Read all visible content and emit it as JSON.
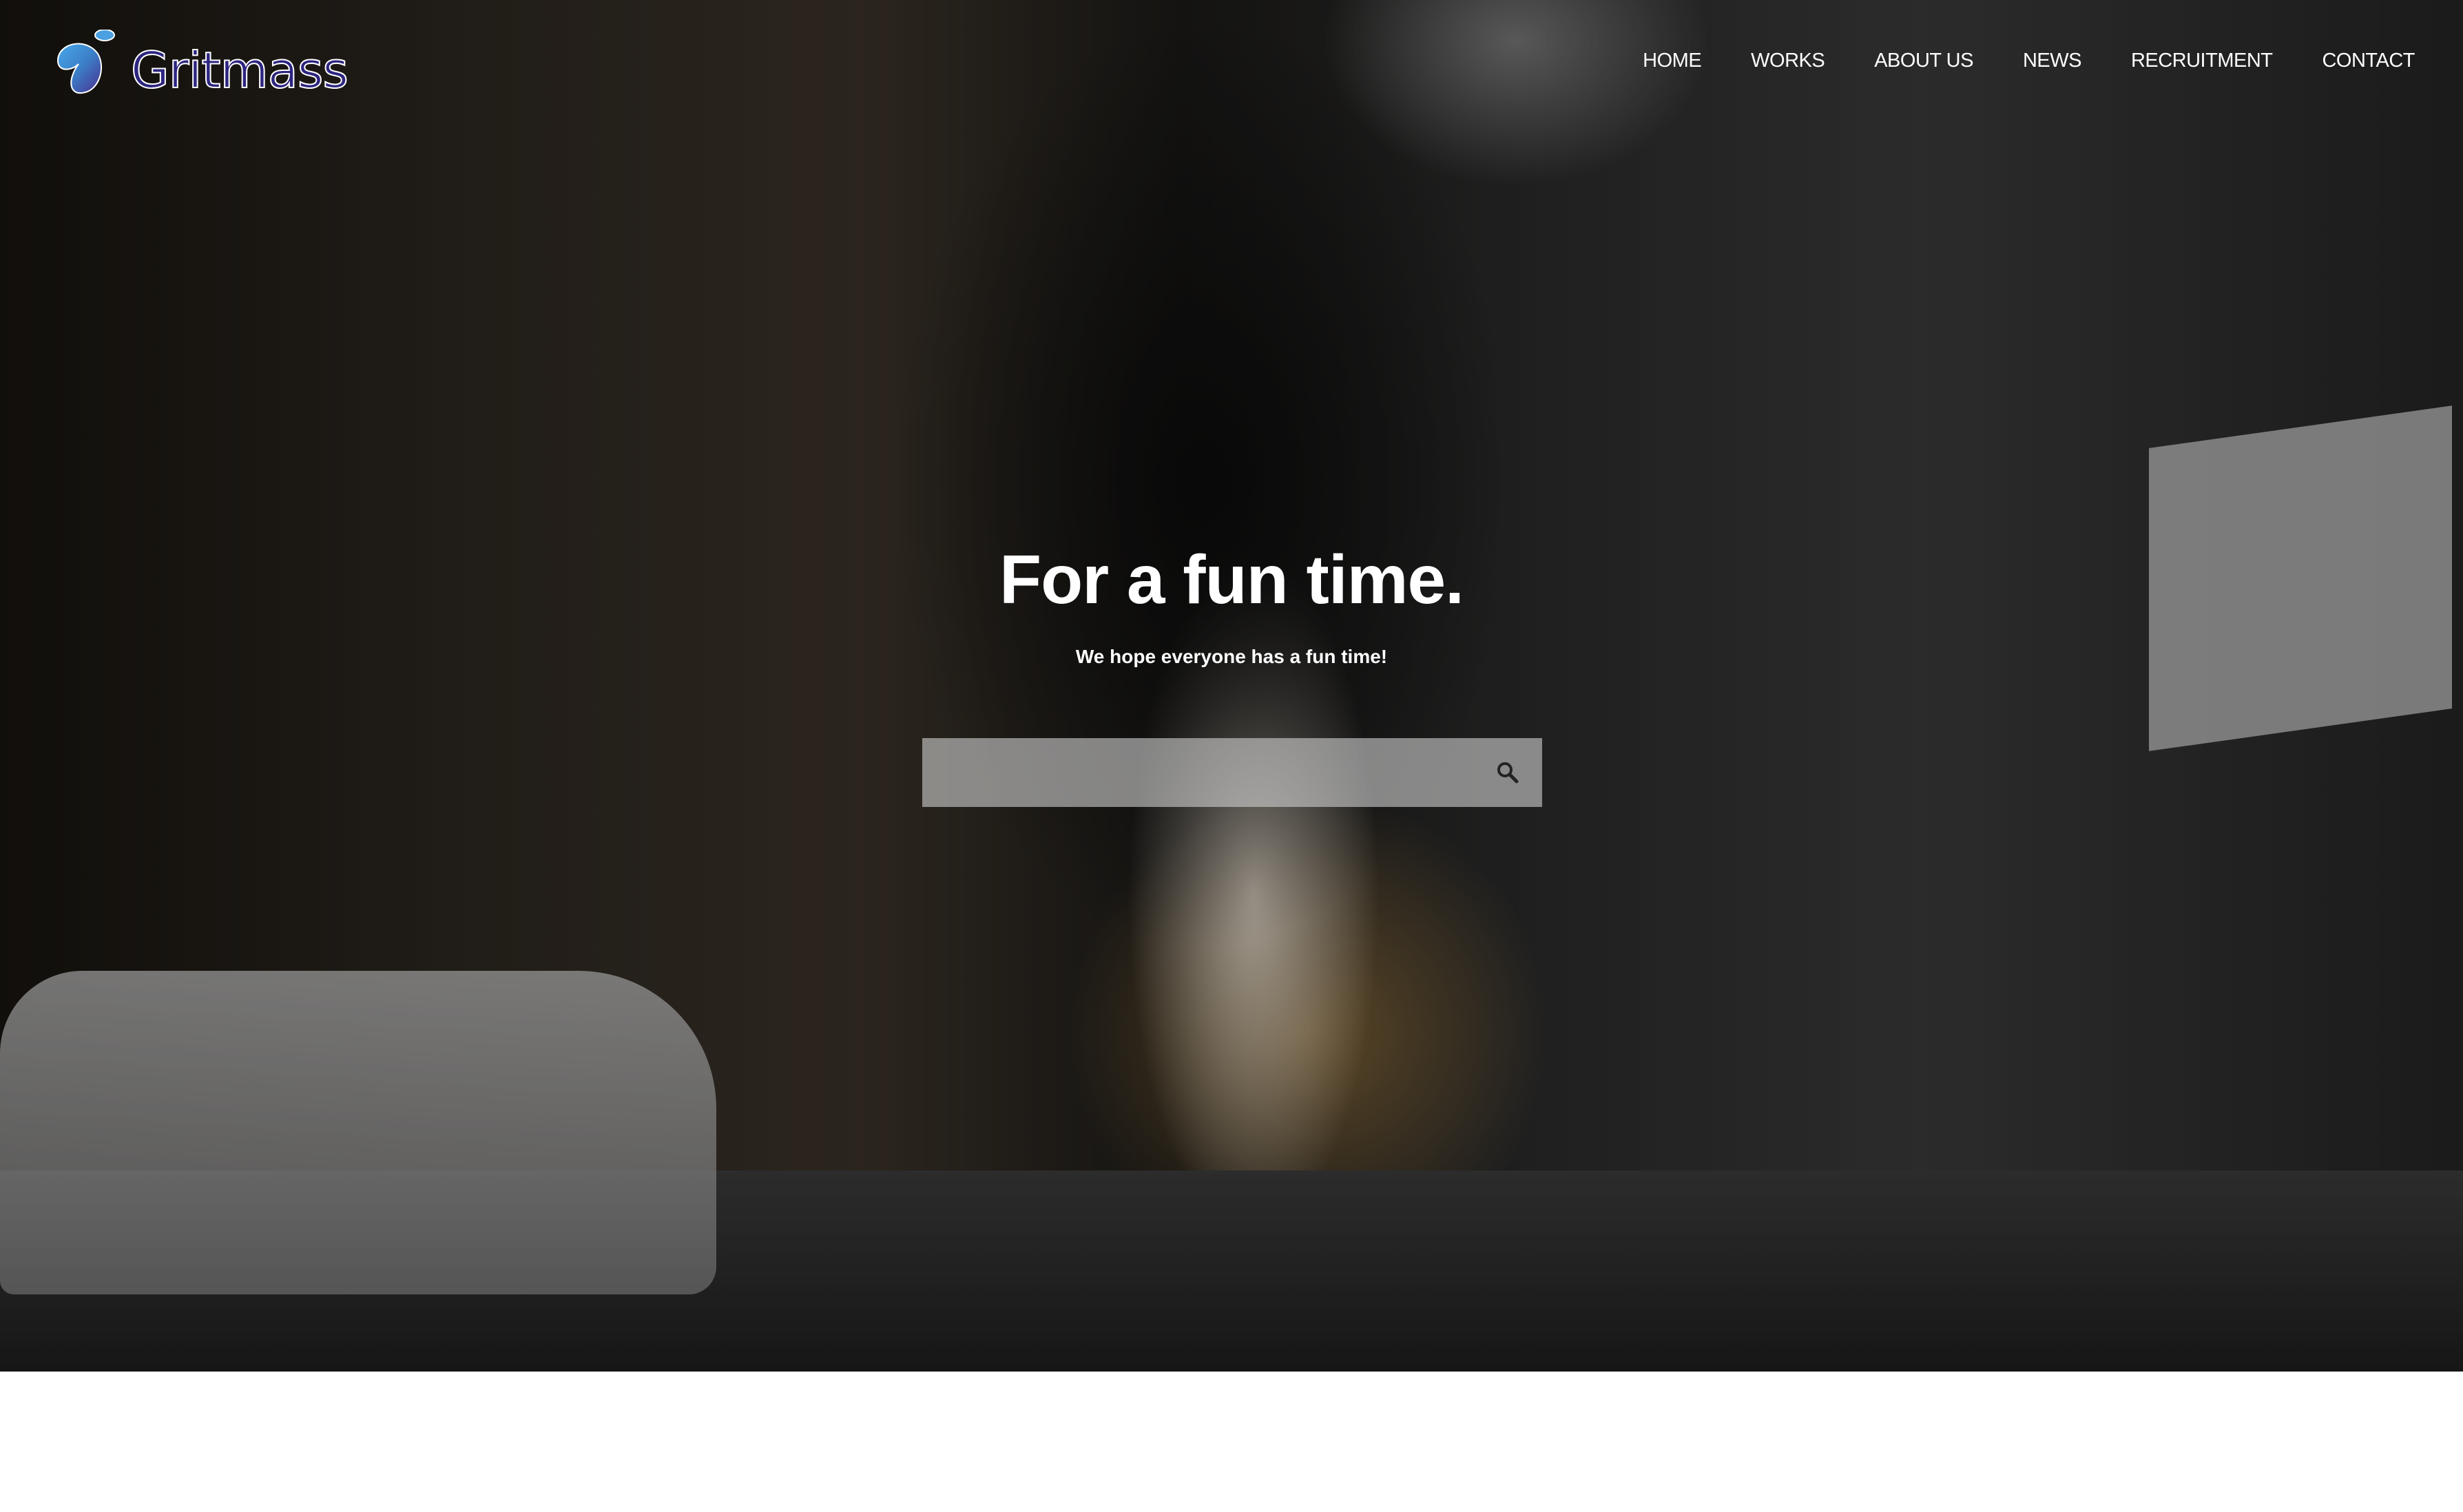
{
  "brand": {
    "name": "Gritmass",
    "logo_colors": [
      "#3fa0e0",
      "#4a2f8f"
    ]
  },
  "nav": {
    "items": [
      {
        "label": "HOME"
      },
      {
        "label": "WORKS"
      },
      {
        "label": "ABOUT US"
      },
      {
        "label": "NEWS"
      },
      {
        "label": "RECRUITMENT"
      },
      {
        "label": "CONTACT"
      }
    ]
  },
  "hero": {
    "title": "For a fun time.",
    "subtitle": "We hope everyone has a fun time!",
    "search": {
      "value": "",
      "placeholder": "",
      "icon": "search-icon"
    }
  }
}
